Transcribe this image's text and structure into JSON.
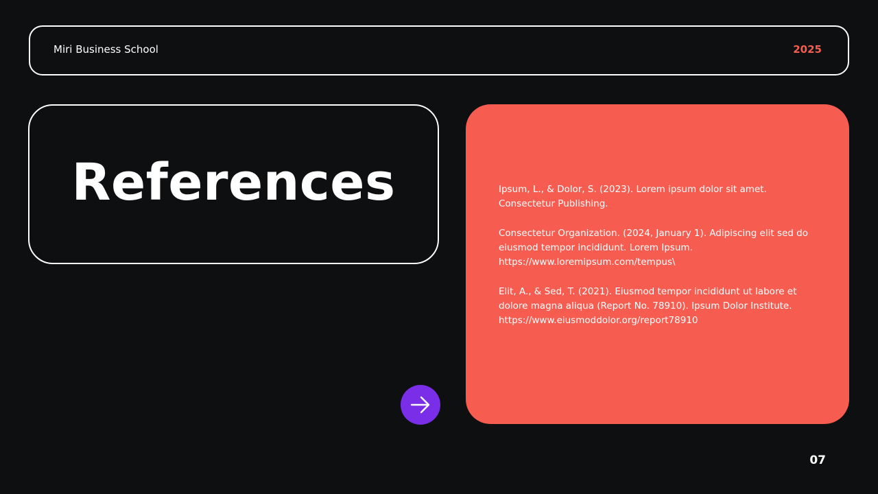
{
  "header": {
    "school": "Miri Business School",
    "year": "2025"
  },
  "title": "References",
  "references": [
    "Ipsum, L., & Dolor, S. (2023). Lorem ipsum dolor sit amet. Consectetur Publishing.",
    "Consectetur Organization. (2024, January 1). Adipiscing elit sed do eiusmod tempor incididunt. Lorem Ipsum. https://www.loremipsum.com/tempus\\",
    "Elit, A., & Sed, T. (2021). Eiusmod tempor incididunt ut labore et dolore magna aliqua (Report No. 78910). Ipsum Dolor Institute. https://www.eiusmoddolor.org/report78910"
  ],
  "page_number": "07",
  "icons": {
    "next": "arrow-right-icon"
  },
  "colors": {
    "background": "#0e0f10",
    "accent": "#f65c4f",
    "button": "#7a2ee8"
  }
}
